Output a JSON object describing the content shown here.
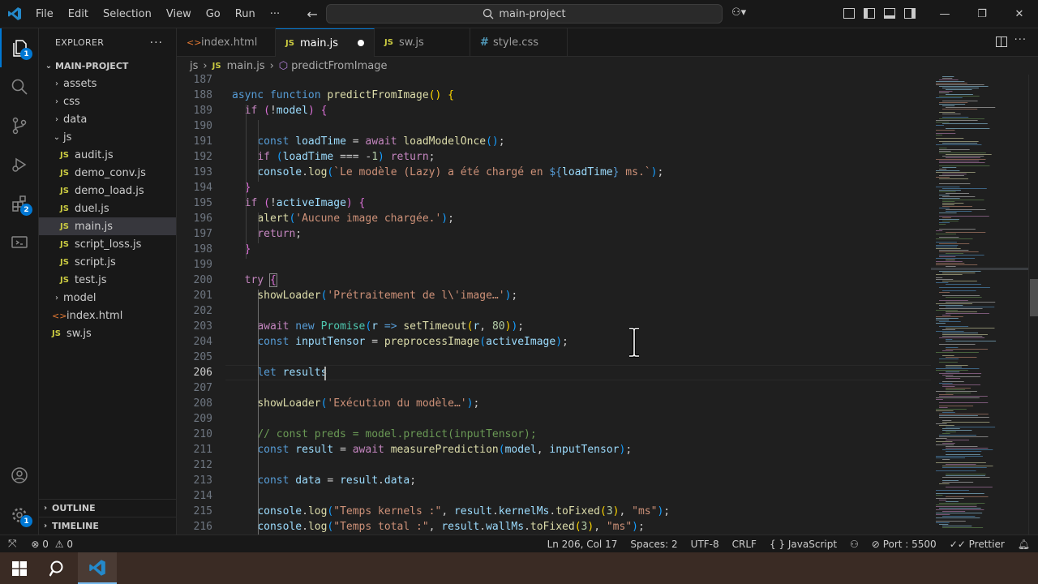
{
  "menu": [
    "File",
    "Edit",
    "Selection",
    "View",
    "Go",
    "Run",
    "···"
  ],
  "search": {
    "text": "main-project"
  },
  "activity": {
    "explorer_badge": "1",
    "extensions_badge": "2",
    "settings_badge": "1"
  },
  "sidebar": {
    "title": "EXPLORER",
    "project": "MAIN-PROJECT",
    "folders": {
      "assets": "assets",
      "css": "css",
      "data": "data",
      "js": "js",
      "model": "model"
    },
    "js_files": [
      "audit.js",
      "demo_conv.js",
      "demo_load.js",
      "duel.js",
      "main.js",
      "script_loss.js",
      "script.js",
      "test.js"
    ],
    "root_files": {
      "index": "index.html",
      "sw": "sw.js"
    },
    "outline": "OUTLINE",
    "timeline": "TIMELINE"
  },
  "tabs": [
    {
      "label": "index.html",
      "icon": "<>"
    },
    {
      "label": "main.js",
      "icon": "JS"
    },
    {
      "label": "sw.js",
      "icon": "JS"
    },
    {
      "label": "style.css",
      "icon": "#"
    }
  ],
  "breadcrumb": {
    "folder": "js",
    "file": "main.js",
    "symbol": "predictFromImage"
  },
  "editor": {
    "line_numbers": [
      "187",
      "188",
      "189",
      "190",
      "191",
      "192",
      "193",
      "194",
      "195",
      "196",
      "197",
      "198",
      "199",
      "200",
      "201",
      "202",
      "203",
      "204",
      "205",
      "206",
      "207",
      "208",
      "209",
      "210",
      "211",
      "212",
      "213",
      "214",
      "215",
      "216"
    ],
    "current_line": "206"
  },
  "status": {
    "errors": "0",
    "warnings": "0",
    "position": "Ln 206, Col 17",
    "spaces": "Spaces: 2",
    "encoding": "UTF-8",
    "eol": "CRLF",
    "language": "JavaScript",
    "port": "Port : 5500",
    "formatter": "Prettier"
  },
  "colors": {
    "accent": "#0078d4",
    "bg": "#1f1f1f",
    "chrome": "#181818"
  },
  "icons": [
    "vscode-logo",
    "explorer-icon",
    "search-icon",
    "source-control-icon",
    "run-debug-icon",
    "extensions-icon",
    "remote-icon",
    "account-icon",
    "settings-gear-icon",
    "windows-start-icon",
    "taskbar-search-icon",
    "taskbar-vscode-icon"
  ]
}
